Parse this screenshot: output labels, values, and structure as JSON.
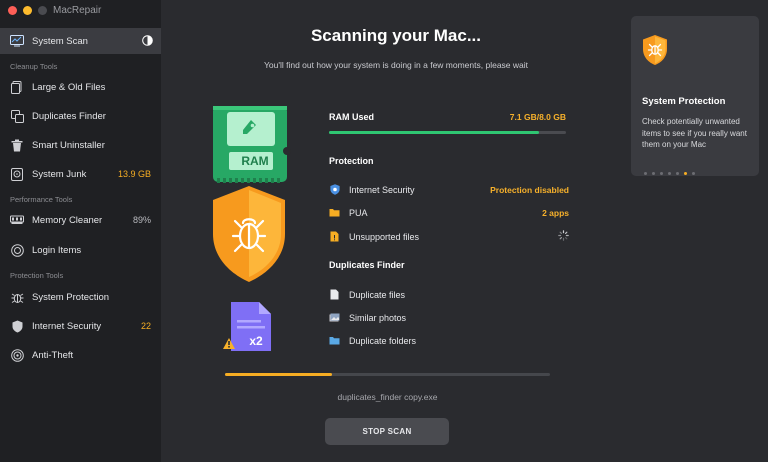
{
  "window": {
    "title": "MacRepair"
  },
  "sidebar": {
    "items": [
      {
        "label": "System Scan",
        "value": ""
      },
      {
        "label": "Large & Old Files",
        "value": ""
      },
      {
        "label": "Duplicates Finder",
        "value": ""
      },
      {
        "label": "Smart Uninstaller",
        "value": ""
      },
      {
        "label": "System Junk",
        "value": "13.9 GB"
      },
      {
        "label": "Memory Cleaner",
        "value": "89%"
      },
      {
        "label": "Login Items",
        "value": ""
      },
      {
        "label": "System Protection",
        "value": ""
      },
      {
        "label": "Internet Security",
        "value": "22"
      },
      {
        "label": "Anti-Theft",
        "value": ""
      }
    ],
    "sections": {
      "cleanup": "Cleanup Tools",
      "performance": "Performance Tools",
      "protection": "Protection Tools"
    }
  },
  "main": {
    "title": "Scanning your Mac...",
    "subtitle": "You'll find out how your system is doing in a few moments, please wait",
    "art": {
      "ram_label": "RAM",
      "dup_label": "x2"
    },
    "ram": {
      "label": "RAM Used",
      "value": "7.1 GB/8.0 GB",
      "fraction": 0.8875
    },
    "protection": {
      "heading": "Protection",
      "items": [
        {
          "label": "Internet Security",
          "status": "Protection disabled"
        },
        {
          "label": "PUA",
          "status": "2 apps"
        },
        {
          "label": "Unsupported files",
          "status": ""
        }
      ]
    },
    "duplicates": {
      "heading": "Duplicates Finder",
      "items": [
        {
          "label": "Duplicate files"
        },
        {
          "label": "Similar photos"
        },
        {
          "label": "Duplicate folders"
        }
      ]
    },
    "progress": 0.33,
    "current_file": "duplicates_finder copy.exe",
    "stop_label": "STOP SCAN"
  },
  "card": {
    "title": "System Protection",
    "text": "Check potentially unwanted items to see if you really want them on your Mac",
    "active_dot": 6,
    "dot_count": 7
  },
  "colors": {
    "accent": "#f6ad23",
    "ram_green": "#2fc672",
    "sidebar_bg": "#1f2023",
    "main_bg": "#2a2b2f"
  }
}
